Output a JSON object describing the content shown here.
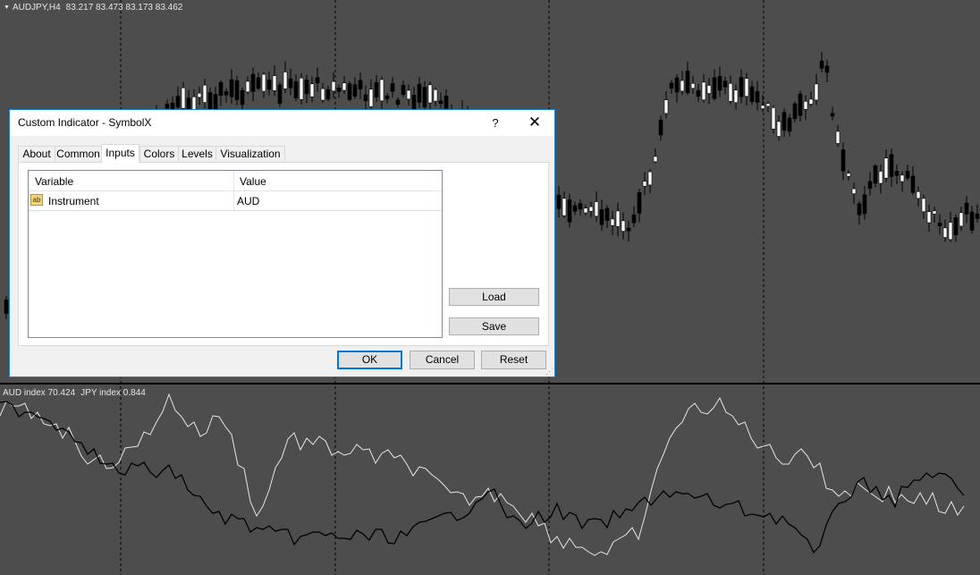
{
  "chart": {
    "symbol_period": "AUDJPY,H4",
    "ohlc": "83.217 83.473 83.173 83.462",
    "indicator_legend": [
      {
        "label": "AUD index 70.424"
      },
      {
        "label": "JPY index 0.844"
      }
    ],
    "colors": {
      "background": "#4d4d4d",
      "bull_candle": "#ffffff",
      "bear_candle": "#000000",
      "grid": "#000000",
      "aud_line": "#e6e6e6",
      "jpy_line": "#000000"
    }
  },
  "dialog": {
    "title": "Custom Indicator - SymbolX",
    "help_label": "?",
    "close_label": "✕",
    "tabs": [
      {
        "label": "About"
      },
      {
        "label": "Common"
      },
      {
        "label": "Inputs",
        "active": true
      },
      {
        "label": "Colors"
      },
      {
        "label": "Levels"
      },
      {
        "label": "Visualization"
      }
    ],
    "grid": {
      "col_variable": "Variable",
      "col_value": "Value",
      "rows": [
        {
          "icon": "ab",
          "variable": "Instrument",
          "value": "AUD"
        }
      ]
    },
    "load_label": "Load",
    "save_label": "Save",
    "ok_label": "OK",
    "cancel_label": "Cancel",
    "reset_label": "Reset",
    "grip_glyph": "⋰"
  }
}
